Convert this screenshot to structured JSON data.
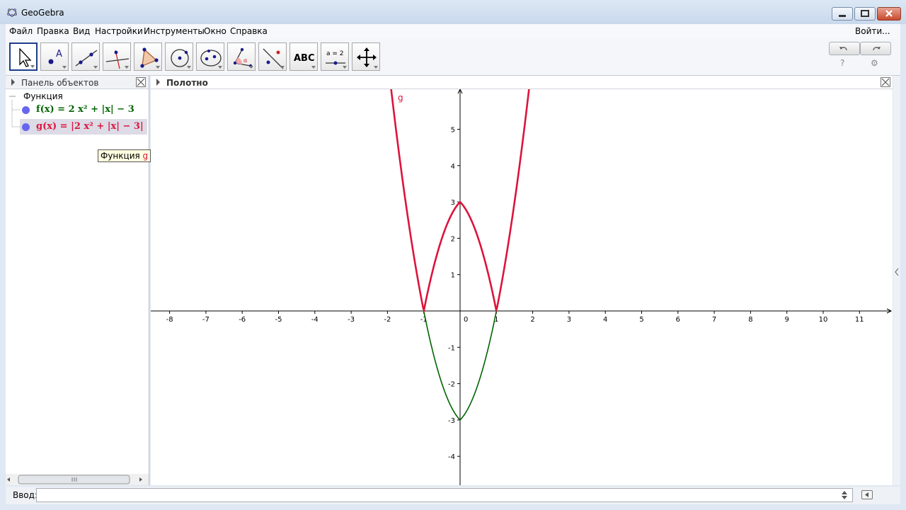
{
  "window": {
    "title": "GeoGebra"
  },
  "menu": {
    "items": [
      "Файл",
      "Правка",
      "Вид",
      "Настройки",
      "Инструменты",
      "Окно",
      "Справка"
    ],
    "login": "Войти..."
  },
  "toolbar": {
    "tools": [
      "move-tool",
      "point-tool",
      "line-tool",
      "perpendicular-tool",
      "polygon-tool",
      "circle-tool",
      "ellipse-tool",
      "angle-tool",
      "reflect-tool",
      "text-tool",
      "slider-tool",
      "move-view-tool"
    ],
    "text_tool_label": "ABC",
    "slider_tool_label": "a = 2",
    "help": "?",
    "settings": "⚙"
  },
  "algebra": {
    "title": "Панель объектов",
    "group": "Функция",
    "objects": [
      {
        "name": "f",
        "definition": "f(x) = 2 x² + |x| − 3",
        "color": "#006400"
      },
      {
        "name": "g",
        "definition": "g(x) = |2 x² + |x| − 3|",
        "color": "#dc143c"
      }
    ],
    "tooltip_prefix": "Функция",
    "tooltip_name": "g"
  },
  "graphics": {
    "title": "Полотно",
    "curve_label": "g",
    "x_ticks": [
      -8,
      -7,
      -6,
      -5,
      -4,
      -3,
      -2,
      -1,
      0,
      1,
      2,
      3,
      4,
      5,
      6,
      7,
      8,
      9,
      10,
      11
    ],
    "y_ticks": [
      -4,
      -3,
      -2,
      -1,
      1,
      2,
      3,
      4,
      5
    ]
  },
  "input": {
    "label": "Ввод:",
    "value": ""
  }
}
